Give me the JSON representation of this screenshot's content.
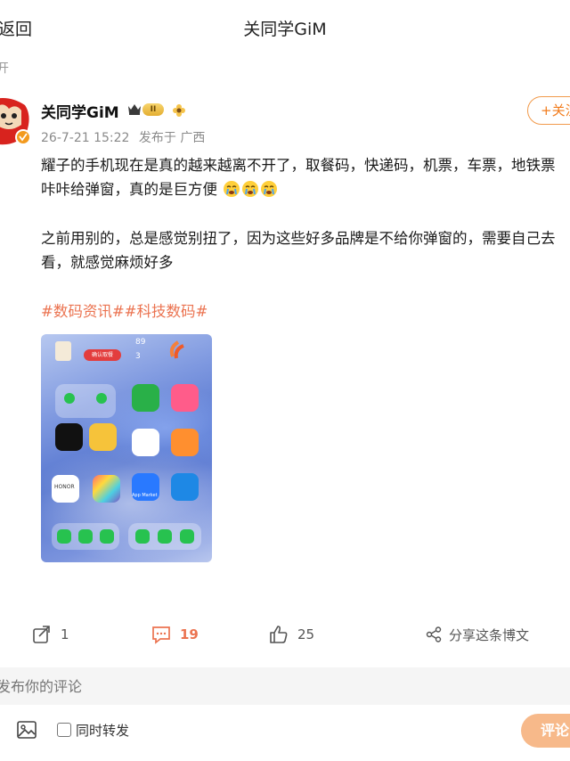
{
  "header": {
    "back_label": "返回",
    "title": "关同学GiM",
    "expand_fragment": "开"
  },
  "author": {
    "name": "关同学GiM",
    "level_badge": "II",
    "timestamp": "26-7-21 15:22",
    "published_from": "发布于 广西",
    "follow_label": "+关注"
  },
  "post": {
    "lines": [
      "耀子的手机现在是真的越来越离不开了，取餐码，快递码，机票，车票，地铁票",
      "咔咔给弹窗，真的是巨方便",
      "之前用别的，总是感觉别扭了，因为这些好多品牌是不给你弹窗的，需要自己去",
      "看，就感觉麻烦好多"
    ],
    "hashtags": "#数码资讯##科技数码#",
    "image": {
      "confirm_pill": "确认取餐",
      "honor_label": "HONOR",
      "appmarket_label": "App Market",
      "temp": "89",
      "temp_small": "3"
    }
  },
  "actions": {
    "repost_count": "1",
    "comment_count": "19",
    "like_count": "25",
    "share_label": "分享这条博文"
  },
  "composer": {
    "placeholder": "发布你的评论",
    "repost_checkbox_label": "同时转发",
    "submit_label": "评论"
  },
  "colors": {
    "accent": "#eb7350",
    "follow_orange": "#f27c1c",
    "submit_bg": "#f7b98a"
  }
}
